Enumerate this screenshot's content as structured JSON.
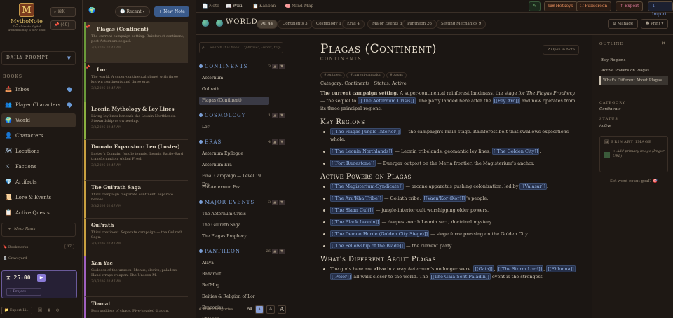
{
  "app": {
    "name": "MythoNote",
    "tagline": "The ultimate digital worldbuilding & lore book"
  },
  "sidebar": {
    "search_badge": "⌘K",
    "pin_badge": "(49)",
    "daily_prompt": "DAILY PROMPT",
    "books_header": "BOOKS",
    "books": [
      {
        "label": "Inbox",
        "icon": "📥"
      },
      {
        "label": "Player Characters",
        "icon": "👥"
      },
      {
        "label": "World",
        "icon": "🌍"
      },
      {
        "label": "Characters",
        "icon": "👤"
      },
      {
        "label": "Locations",
        "icon": "🗺"
      },
      {
        "label": "Factions",
        "icon": "⚔"
      },
      {
        "label": "Artifacts",
        "icon": "💎"
      },
      {
        "label": "Lore & Events",
        "icon": "📜"
      },
      {
        "label": "Active Quests",
        "icon": "📋"
      }
    ],
    "new_book": "New Book",
    "bookmarks": "Bookmarks",
    "bookmarks_count": "17",
    "graveyard": "Graveyard",
    "timer": "25:00",
    "project": "+ Project",
    "export": "Export Li..."
  },
  "notelist": {
    "sort": "Recent",
    "new_note": "+ New Note",
    "notes": [
      {
        "title": "Plagas (Continent)",
        "excerpt": "The current campaign setting. Rainforest continent, post-Aeternum sequel.",
        "date": "3/3/2026 02:47 AM",
        "color": "#6a9a3a"
      },
      {
        "title": "Lor",
        "excerpt": "The world. A super-continental planet with three known continents and three eras",
        "date": "3/3/2026 02:47 AM",
        "color": "#6a9a3a"
      },
      {
        "title": "Leonin Mythology & Ley Lines",
        "excerpt": "Living ley lines beneath the Leonin Northlands. Stewardship vs ownership.",
        "date": "3/3/2026 02:47 AM",
        "color": "#8ab040"
      },
      {
        "title": "Domain Expansion: Leo (Luster)",
        "excerpt": "Luster's Domain. Jungle temple, Leonin Battle-Bard transformation, global Fresh",
        "date": "3/3/2026 02:47 AM",
        "color": "#c9a040"
      },
      {
        "title": "The Gul'rath Saga",
        "excerpt": "Third campaign. Separate continent, separate heroes.",
        "date": "3/3/2026 02:47 AM",
        "color": "#c9a040"
      },
      {
        "title": "Gul'rath",
        "excerpt": "Third continent. Separate campaign — the Gul'rath Saga.",
        "date": "3/3/2026 02:47 AM",
        "color": "#c9a040"
      },
      {
        "title": "Xan Yae",
        "excerpt": "Goddess of the unseen. Monks, clerics, paladins. Hand-wraps weapon. The Unseen M.",
        "date": "3/3/2026 02:47 AM",
        "color": "#a060c0"
      },
      {
        "title": "Tiamat",
        "excerpt": "Fem goddess of chaos. Five-headed dragon.",
        "date": "",
        "color": "#a060c0"
      }
    ]
  },
  "tabs": [
    {
      "label": "Note",
      "icon": "📄"
    },
    {
      "label": "Wiki",
      "icon": "📖"
    },
    {
      "label": "Kanban",
      "icon": "📋"
    },
    {
      "label": "Mind Map",
      "icon": "🧠"
    }
  ],
  "toolbar": {
    "pen": "✎",
    "hotkeys": "Hotkeys",
    "fullscreen": "Fullscreen",
    "export": "↑ Export",
    "import": "↓ Import"
  },
  "wiki": {
    "title": "WORLD",
    "chips": [
      {
        "label": "All 44"
      },
      {
        "label": "Continents 3"
      },
      {
        "label": "Cosmology 1"
      },
      {
        "label": "Eras 4"
      },
      {
        "label": "Major Events 3"
      },
      {
        "label": "Pantheon 26"
      },
      {
        "label": "Setting Mechanics 9"
      }
    ],
    "manage": "⚙ Manage",
    "print": "Print ▾",
    "search_placeholder": "Search this book... \"phrase\", -word, tag:",
    "categories": [
      {
        "name": "CONTINENTS",
        "count": "3",
        "items": [
          "Aeternum",
          "Gul'rath",
          "Plagas (Continent)"
        ]
      },
      {
        "name": "COSMOLOGY",
        "count": "1",
        "items": [
          "Lor"
        ]
      },
      {
        "name": "ERAS",
        "count": "4",
        "items": [
          "Aeternum Epilogue",
          "Aeternum Era",
          "Final Campaign — Level 19 Era",
          "Pre-Aeternum Era"
        ]
      },
      {
        "name": "MAJOR EVENTS",
        "count": "3",
        "items": [
          "The Aeternum Crisis",
          "The Gul'rath Saga",
          "The Plagas Prophecy"
        ]
      },
      {
        "name": "PANTHEON",
        "count": "26",
        "items": [
          "Alaya",
          "Bahamut",
          "Bel'Mog",
          "Deities & Religion of Lor",
          "Draconiss",
          "Ehlonna"
        ]
      }
    ],
    "footer": "6 Wiki categories",
    "font_sizes": [
      "Aa",
      "A",
      "A",
      "A"
    ]
  },
  "doc": {
    "open_in_note": "↗ Open in Note",
    "title": "Plagas (Continent)",
    "subtitle": "CONTINENTS",
    "tags": [
      "#continent",
      "#current-campaign",
      "#plagas"
    ],
    "meta": "Category: Continents | Status: Active",
    "intro_bold": "The current campaign setting.",
    "intro_a": " A super-continental rainforest landmass, the stage for ",
    "intro_italic": "The Plagas Prophecy",
    "intro_b": " — the sequel to ",
    "intro_link1": "[[The Aeternum Crisis]]",
    "intro_c": ". The party landed here after the ",
    "intro_link2": "[[Fey Arc]]",
    "intro_d": " and now operates from its three principal regions.",
    "h_regions": "Key Regions",
    "regions": [
      {
        "link": "[[The Plagas Jungle Interior]]",
        "text": " — the campaign's main stage. Rainforest belt that swallows expeditions whole."
      },
      {
        "link": "[[The Leonin Northlands]]",
        "text": " — Leonin tribelands, geomantic ley lines, ",
        "link2": "[[The Golden City]]",
        "text2": "."
      },
      {
        "link": "[[Fort Runestone]]",
        "text": " — Duergar outpost on the Meria frontier, the Magisterium's anchor."
      }
    ],
    "h_powers": "Active Powers on Plagas",
    "powers": [
      {
        "link": "[[The Magisterium-Syndicate]]",
        "text": " — arcane apparatus pushing colonization; led by ",
        "link2": "[[Valasar]]",
        "text2": "."
      },
      {
        "link": "[[The Aru'Kha Tribe]]",
        "text": " — Goliath tribe; ",
        "link2": "[[Vaen'Kor (Kor)]]",
        "text2": "'s people."
      },
      {
        "link": "[[The Slaan Cult]]",
        "text": " — jungle-interior cult worshipping older powers."
      },
      {
        "link": "[[The Black Leonin]]",
        "text": " — deepest-north Leonin sect; doctrinal mystery."
      },
      {
        "link": "[[The Demon Horde (Golden City Siege)]]",
        "text": " — siege force pressing on the Golden City."
      },
      {
        "link": "[[The Fellowship of the Blade]]",
        "text": " — the current party."
      }
    ],
    "h_diff": "What's Different About Plagas",
    "diff_a": "The gods here are ",
    "diff_bold": "alive",
    "diff_b": " in a way Aeternum's no longer were. ",
    "diff_l1": "[[Gaia]]",
    "diff_c": ", ",
    "diff_l2": "[[The Storm Lord]]",
    "diff_d": ", ",
    "diff_l3": "[[Ehlonna]]",
    "diff_e": ", ",
    "diff_l4": "[[Pelor]]",
    "diff_f": " all walk closer to the world. The ",
    "diff_l5": "[[The Gaia-Sent Paladin]]",
    "diff_g": " event is the strongest"
  },
  "outline": {
    "header": "OUTLINE",
    "items": [
      "Key Regions",
      "Active Powers on Plagas",
      "What's Different About Plagas"
    ],
    "category_label": "CATEGORY",
    "category_value": "Continents",
    "status_label": "STATUS",
    "status_value": "Active",
    "primary_image": "PRIMARY IMAGE",
    "add_image": "+ Add primary image (Imgur URL)",
    "word_goal": "Set word count goal? 🎯"
  }
}
